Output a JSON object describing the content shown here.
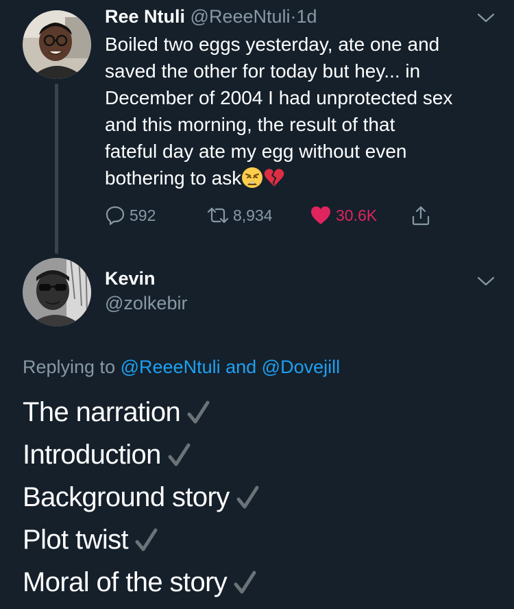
{
  "colors": {
    "background": "#15202b",
    "primary_text": "#ffffff",
    "secondary_text": "#8899a6",
    "mention": "#1da1f2",
    "like": "#e0245e",
    "thread_line": "#38444d"
  },
  "tweet": {
    "display_name": "Ree Ntuli",
    "handle": "@ReeeNtuli",
    "separator": "·",
    "time": "1d",
    "text_lines": [
      "Boiled two eggs yesterday, ate one and",
      "saved the other for today but hey... in",
      "December of 2004 I had unprotected sex",
      "and this morning, the result of that",
      "fateful day ate my egg without even",
      "bothering to ask"
    ],
    "emojis": [
      "weary-face-emoji",
      "broken-heart-emoji"
    ],
    "actions": {
      "reply_count": "592",
      "retweet_count": "8,934",
      "like_count": "30.6K",
      "liked": true
    },
    "menu_icon": "chevron-down-icon"
  },
  "reply": {
    "display_name": "Kevin",
    "handle": "@zolkebir",
    "replying_prefix": "Replying to",
    "replying_mentions": [
      "@ReeeNtuli",
      "@Dovejill"
    ],
    "replying_joiner": "and",
    "lines": [
      "The narration",
      "Introduction",
      "Background story",
      "Plot twist",
      "Moral of the story"
    ],
    "line_icon": "check-mark-icon",
    "menu_icon": "chevron-down-icon"
  }
}
